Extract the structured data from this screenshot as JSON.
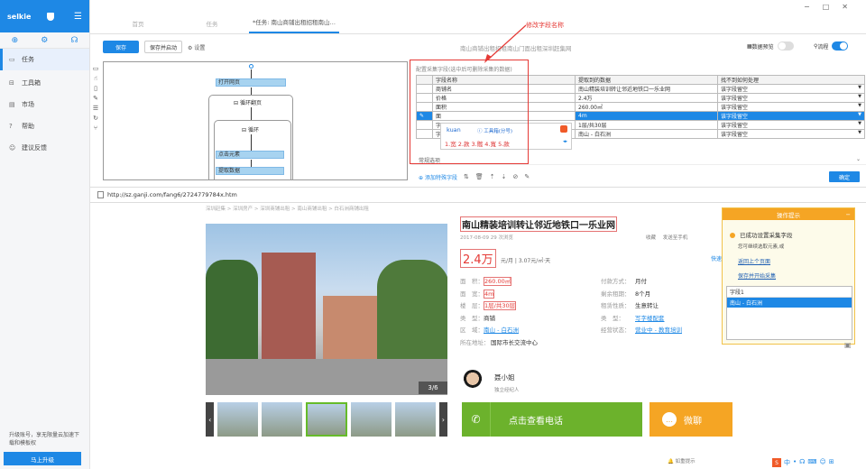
{
  "app": {
    "brand": "selkie"
  },
  "sidebar": {
    "items": [
      {
        "label": "任务",
        "icon": "task-icon"
      },
      {
        "label": "工具箱",
        "icon": "toolbox-icon"
      },
      {
        "label": "市场",
        "icon": "market-icon"
      },
      {
        "label": "帮助",
        "icon": "help-icon"
      },
      {
        "label": "建议反馈",
        "icon": "feedback-icon"
      }
    ],
    "upgrade_text": "升级账号，享无限量云加速下载和模板权",
    "upgrade_button": "马上升级"
  },
  "tabs": [
    {
      "label": "首页"
    },
    {
      "label": "任务"
    },
    {
      "label": "*任务: 南山商铺出租招租南山…"
    }
  ],
  "toolbar": {
    "save": "保存",
    "save_start": "保存并启动",
    "settings": "设置",
    "workflow_title": "南山商铺出租招租南山门面出租深圳赶集网",
    "preview_label": "数据预览",
    "flow_label": "流程",
    "preview_on": false,
    "flow_on": true
  },
  "flow": {
    "open_page": "打开网页",
    "loop_page": "循环翻页",
    "loop": "循环",
    "click": "点击元素",
    "extract": "提取数据"
  },
  "fields": {
    "caption": "配置采集字段(选中后可删除采集的数据)",
    "headers": [
      "字段名称",
      "提取到的数据",
      "找不到如何处理"
    ],
    "rows": [
      [
        "商铺名",
        "南山精装培训转让邻近地铁口一乐业网",
        "该字段留空"
      ],
      [
        "价格",
        "2.4万",
        "该字段留空"
      ],
      [
        "面积",
        "260.00㎡",
        "该字段留空"
      ],
      [
        "面",
        "4m",
        "该字段留空"
      ],
      [
        "字",
        "1层/共30层",
        "该字段留空"
      ],
      [
        "字",
        "南山 - 白石洲",
        "该字段留空"
      ]
    ],
    "selected_row": 3,
    "row_options": "常规选项",
    "add_field": "添加特殊字段",
    "confirm": "确定"
  },
  "ime": {
    "typed": "kuan",
    "hint": "工具箱(分号)",
    "candidates": "1.宽 2.款 3.髋 4.寬 5.款"
  },
  "annotation": {
    "text": "修改字段名称",
    "color": "#e53935"
  },
  "browser": {
    "url": "http://sz.ganji.com/fang6/2724779784x.htm"
  },
  "page": {
    "breadcrumb": "深圳赶集 > 深圳房产 > 深圳商铺出租 > 南山商铺出租 > 白石洲商铺出租",
    "title": "南山精装培训转让邻近地铁口一乐业网",
    "meta": "2017-08-09  29 次浏览",
    "actions": "收藏  发送至手机",
    "price": "2.4万",
    "price_unit": "元/月 | 3.07元/㎡·天",
    "quick": "快速",
    "details_left": [
      {
        "k": "面　积：",
        "v": "260.00㎡",
        "style": "hl"
      },
      {
        "k": "面　宽：",
        "v": "4m",
        "style": "hl"
      },
      {
        "k": "楼　层：",
        "v": "1层/共30层",
        "style": "hl"
      },
      {
        "k": "类　型：",
        "v": "商铺",
        "style": ""
      },
      {
        "k": "区　域：",
        "v": "南山 - 白石洲",
        "style": "ul"
      },
      {
        "k": "所在地址：",
        "v": "国际市长交流中心",
        "style": ""
      }
    ],
    "details_right": [
      {
        "k": "付款方式：",
        "v": "月付",
        "style": ""
      },
      {
        "k": "剩余租期：",
        "v": "8个月",
        "style": ""
      },
      {
        "k": "租赁性质：",
        "v": "生意转让",
        "style": ""
      },
      {
        "k": "类　型：",
        "v": "写字楼配套",
        "style": "ul"
      },
      {
        "k": "经营状态：",
        "v": "营业中 - 教育培训",
        "style": "ul"
      }
    ],
    "photo_counter": "3/6",
    "agent_name": "聂小姐",
    "agent_role": "独立经纪人",
    "call": "点击查看电话",
    "chat": "微聊",
    "tips": "如重提示"
  },
  "ops": {
    "title": "操作提示",
    "success": "已成功设置采集字段",
    "sub": "您可继续选取元素,或",
    "link1": "返回上个页面",
    "link2": "保存并开始采集",
    "list_header": "字段1",
    "list_item": "南山 - 白石洲"
  }
}
